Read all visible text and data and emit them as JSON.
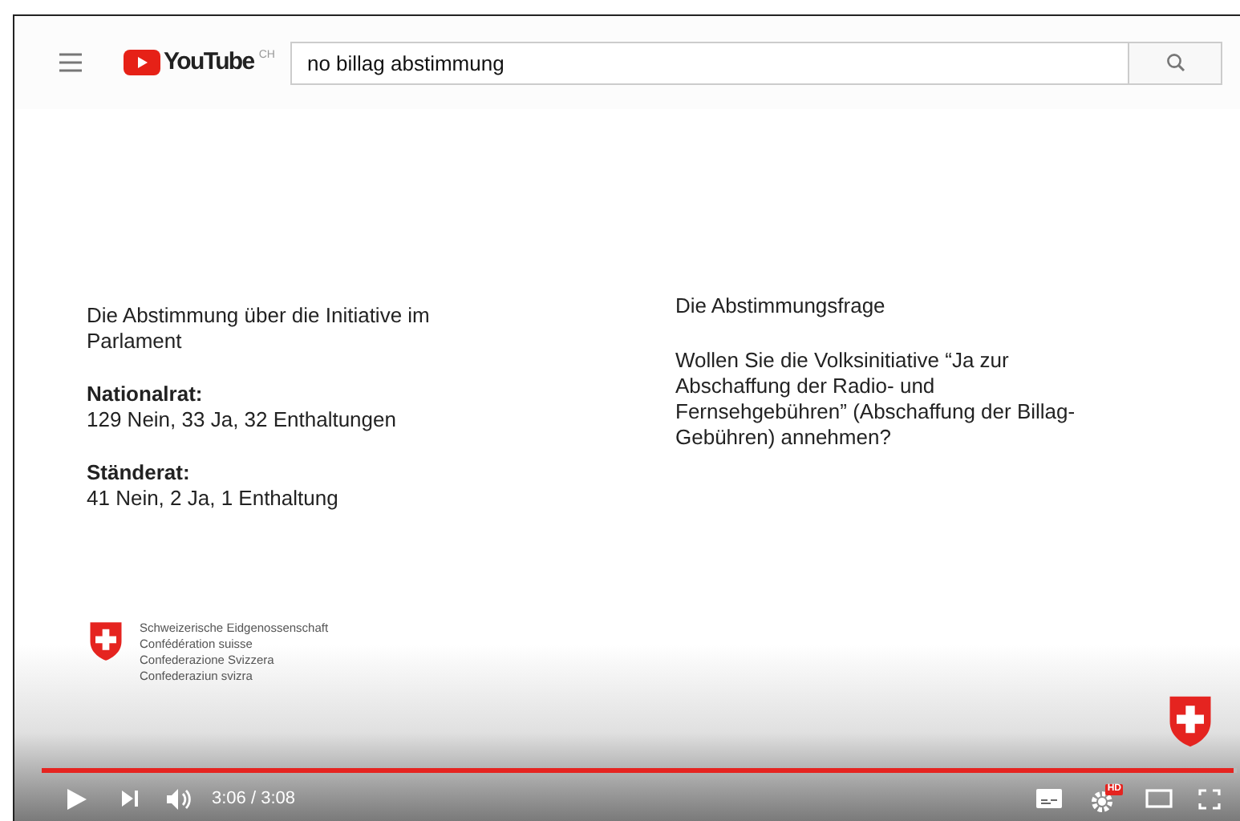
{
  "header": {
    "logo": "YouTube",
    "region": "CH",
    "search": {
      "value": "no billag abstimmung"
    }
  },
  "slide": {
    "left_title": "Die Abstimmung über die Initiative im Parlament",
    "sections": [
      {
        "heading": "Nationalrat:",
        "text": "129 Nein, 33 Ja, 32 Enthaltungen"
      },
      {
        "heading": "Ständerat:",
        "text": "41 Nein, 2 Ja, 1 Enthaltung"
      }
    ],
    "right_title": "Die Abstimmungsfrage",
    "question": "Wollen Sie die Volksinitiative “Ja zur Abschaffung der Radio- und Fernsehgebühren” (Abschaffung der Billag-Gebühren) annehmen?",
    "emblem_lines": [
      "Schweizerische Eidgenossenschaft",
      "Confédération suisse",
      "Confederazione Svizzera",
      "Confederaziun svizra"
    ]
  },
  "player": {
    "progress": {
      "level": 0.997
    },
    "time": "3:06 / 3:08",
    "quality_badge": "HD"
  }
}
